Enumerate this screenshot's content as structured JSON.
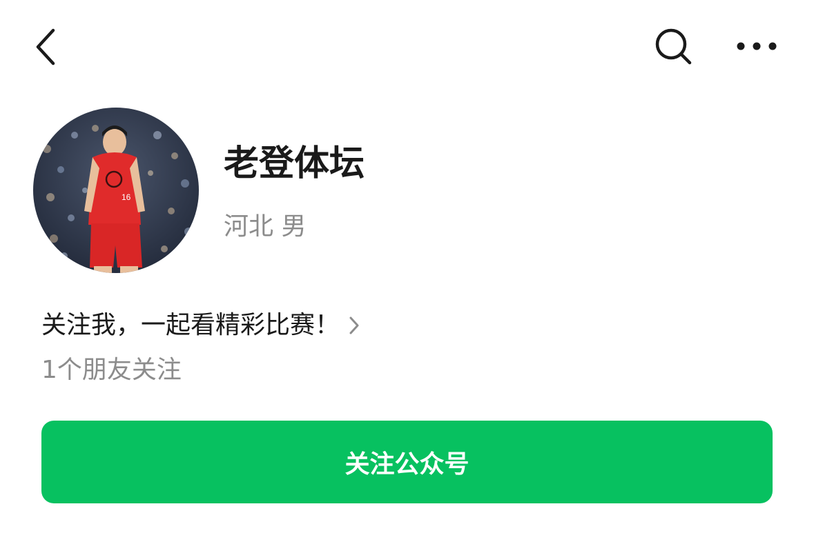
{
  "header": {
    "back_icon": "chevron-left-icon",
    "search_icon": "search-icon",
    "more_icon": "more-horizontal-icon"
  },
  "profile": {
    "name": "老登体坛",
    "location_gender": "河北 男",
    "intro": "关注我，一起看精彩比赛！",
    "friends_following": "1个朋友关注",
    "jersey_number": "16"
  },
  "actions": {
    "follow_label": "关注公众号"
  },
  "colors": {
    "accent": "#07c160",
    "text_primary": "#1a1a1a",
    "text_secondary": "#8c8c8c"
  }
}
